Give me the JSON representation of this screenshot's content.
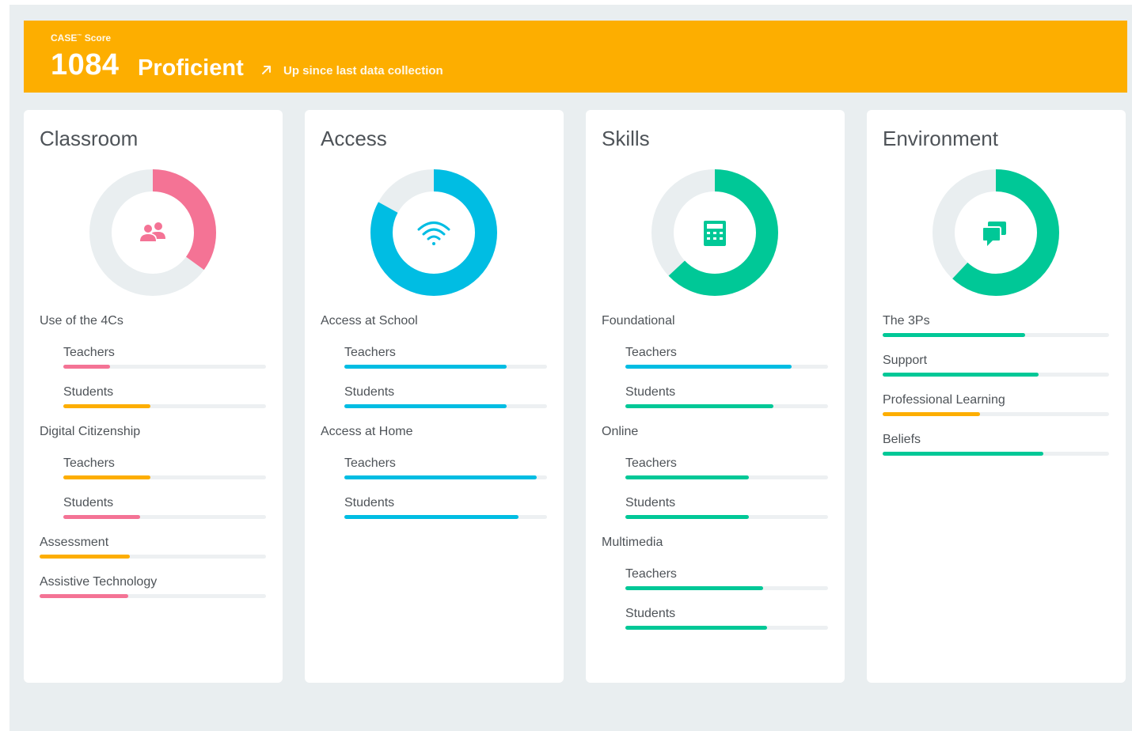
{
  "banner": {
    "label": "CASE",
    "label_mark": "™",
    "label_suffix": "Score",
    "score": "1084",
    "level": "Proficient",
    "trend": "Up since last data collection",
    "trend_icon": "arrow-up-right-icon",
    "color": "#fdae00"
  },
  "colors": {
    "pink": "#f47395",
    "orange": "#fdae00",
    "blue": "#00bde3",
    "green": "#00c897",
    "track": "#e9eef0"
  },
  "cards": [
    {
      "title": "Classroom",
      "icon": "users-icon",
      "donut": {
        "value": 0.35,
        "color": "#f47395"
      },
      "groups": [
        {
          "label": "Use of the 4Cs",
          "rows": [
            {
              "label": "Teachers",
              "value": 0.23,
              "color": "#f47395"
            },
            {
              "label": "Students",
              "value": 0.43,
              "color": "#fdae00"
            }
          ]
        },
        {
          "label": "Digital Citizenship",
          "rows": [
            {
              "label": "Teachers",
              "value": 0.43,
              "color": "#fdae00"
            },
            {
              "label": "Students",
              "value": 0.38,
              "color": "#f47395"
            }
          ]
        }
      ],
      "items": [
        {
          "label": "Assessment",
          "value": 0.4,
          "color": "#fdae00"
        },
        {
          "label": "Assistive Technology",
          "value": 0.39,
          "color": "#f47395"
        }
      ]
    },
    {
      "title": "Access",
      "icon": "wifi-icon",
      "donut": {
        "value": 0.83,
        "color": "#00bde3"
      },
      "groups": [
        {
          "label": "Access at School",
          "rows": [
            {
              "label": "Teachers",
              "value": 0.8,
              "color": "#00bde3"
            },
            {
              "label": "Students",
              "value": 0.8,
              "color": "#00bde3"
            }
          ]
        },
        {
          "label": "Access at Home",
          "rows": [
            {
              "label": "Teachers",
              "value": 0.95,
              "color": "#00bde3"
            },
            {
              "label": "Students",
              "value": 0.86,
              "color": "#00bde3"
            }
          ]
        }
      ],
      "items": []
    },
    {
      "title": "Skills",
      "icon": "calculator-icon",
      "donut": {
        "value": 0.63,
        "color": "#00c897"
      },
      "groups": [
        {
          "label": "Foundational",
          "rows": [
            {
              "label": "Teachers",
              "value": 0.82,
              "color": "#00bde3"
            },
            {
              "label": "Students",
              "value": 0.73,
              "color": "#00c897"
            }
          ]
        },
        {
          "label": "Online",
          "rows": [
            {
              "label": "Teachers",
              "value": 0.61,
              "color": "#00c897"
            },
            {
              "label": "Students",
              "value": 0.61,
              "color": "#00c897"
            }
          ]
        },
        {
          "label": "Multimedia",
          "rows": [
            {
              "label": "Teachers",
              "value": 0.68,
              "color": "#00c897"
            },
            {
              "label": "Students",
              "value": 0.7,
              "color": "#00c897"
            }
          ]
        }
      ],
      "items": []
    },
    {
      "title": "Environment",
      "icon": "chat-bubbles-icon",
      "donut": {
        "value": 0.62,
        "color": "#00c897"
      },
      "groups": [],
      "items": [
        {
          "label": "The 3Ps",
          "value": 0.63,
          "color": "#00c897"
        },
        {
          "label": "Support",
          "value": 0.69,
          "color": "#00c897"
        },
        {
          "label": "Professional Learning",
          "value": 0.43,
          "color": "#fdae00"
        },
        {
          "label": "Beliefs",
          "value": 0.71,
          "color": "#00c897"
        }
      ]
    }
  ]
}
